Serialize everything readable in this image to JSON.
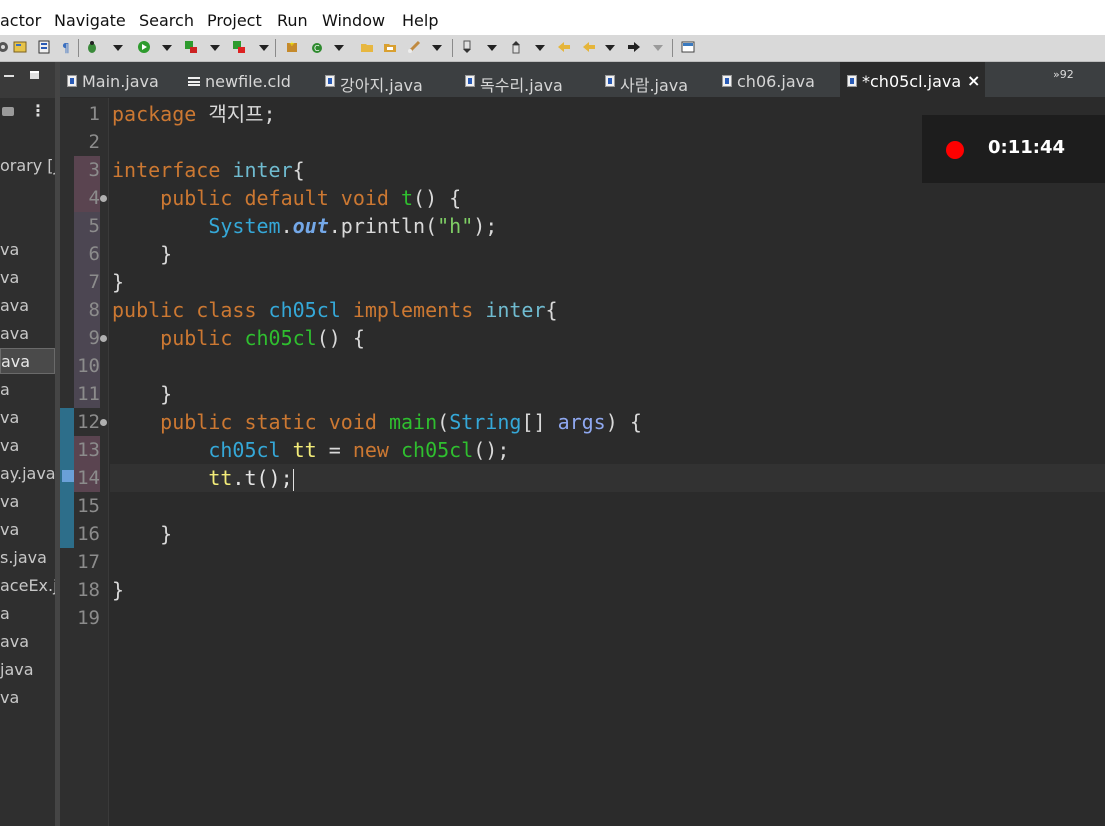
{
  "menu": [
    "actor",
    "Navigate",
    "Search",
    "Project",
    "Run",
    "Window",
    "Help"
  ],
  "explorer": {
    "items": [
      "orary [j",
      "va",
      "va",
      "ava",
      "ava",
      "ava",
      "a",
      "va",
      "va",
      "ay.java",
      "va",
      "va",
      "s.java",
      "aceEx.ja",
      "a",
      "ava",
      "java",
      "va"
    ]
  },
  "tabs": [
    {
      "label": "Main.java",
      "icon": "java-file-icon"
    },
    {
      "label": "newfile.cld",
      "icon": "file-icon"
    },
    {
      "label": "강아지.java",
      "icon": "java-file-icon"
    },
    {
      "label": "독수리.java",
      "icon": "java-file-icon"
    },
    {
      "label": "사람.java",
      "icon": "java-file-icon"
    },
    {
      "label": "ch06.java",
      "icon": "java-file-icon"
    },
    {
      "label": "*ch05cl.java",
      "icon": "java-file-icon",
      "active": true
    }
  ],
  "tab_close": "×",
  "tab_overflow": "»92",
  "editor": {
    "line_numbers": [
      "1",
      "2",
      "3",
      "4",
      "5",
      "6",
      "7",
      "8",
      "9",
      "10",
      "11",
      "12",
      "13",
      "14",
      "15",
      "16",
      "17",
      "18",
      "19"
    ],
    "code": {
      "l1_kw": "package",
      "l1_rest": " 객지프;",
      "l3_kw": "interface",
      "l3_name": "inter",
      "l3_brace": "{",
      "l4_kw": "public default void",
      "l4_name": "t",
      "l4_rest": "() {",
      "l5_cls": "System",
      "l5_dot1": ".",
      "l5_field": "out",
      "l5_call": ".println(",
      "l5_str": "\"h\"",
      "l5_end": ");",
      "l6": "}",
      "l7": "}",
      "l8_kw": "public class",
      "l8_name": "ch05cl",
      "l8_kw2": "implements",
      "l8_iface": "inter",
      "l8_brace": "{",
      "l9_kw": "public",
      "l9_name": "ch05cl",
      "l9_rest": "() {",
      "l11": "}",
      "l12_kw": "public static void",
      "l12_name": "main",
      "l12_p1": "(",
      "l12_cls": "String",
      "l12_p2": "[] ",
      "l12_param": "args",
      "l12_rest": ") {",
      "l13_cls": "ch05cl",
      "l13_var": "tt",
      "l13_eq": " = ",
      "l13_kw": "new",
      "l13_name": "ch05cl",
      "l13_end": "();",
      "l14_var": "tt",
      "l14_call": ".t();",
      "l16": "}",
      "l18": "}"
    }
  },
  "recording": {
    "time": "0:11:44"
  },
  "colors": {
    "keyword": "#cc7832",
    "interface": "#6fbbd0",
    "method": "#2fbf2f",
    "class": "#35a8d8",
    "string": "#7fcf65",
    "record": "#ff0000"
  }
}
